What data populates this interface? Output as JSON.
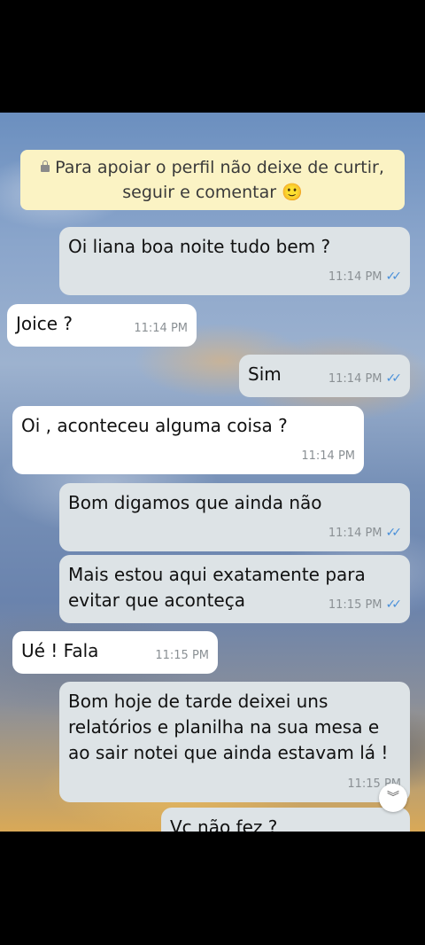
{
  "pinned": {
    "text": "Para apoiar o perfil não deixe de curtir, seguir e comentar 🙂"
  },
  "messages": [
    {
      "text": "Oi liana boa noite tudo bem ?",
      "time": "11:14 PM",
      "read": "✓✓"
    },
    {
      "text": "Joice ?",
      "time": "11:14 PM"
    },
    {
      "text": "Sim",
      "time": "11:14 PM",
      "read": "✓✓"
    },
    {
      "text": "Oi , aconteceu alguma coisa ?",
      "time": "11:14 PM"
    },
    {
      "text": "Bom digamos que ainda não",
      "time": "11:14 PM",
      "read": "✓✓"
    },
    {
      "text": "Mais estou aqui exatamente para evitar que aconteça",
      "time": "11:15 PM",
      "read": "✓✓"
    },
    {
      "text": "Ué ! Fala",
      "time": "11:15 PM"
    },
    {
      "text": "Bom hoje de tarde deixei uns relatórios e planilha na sua mesa e ao sair notei que ainda estavam lá !",
      "time": "11:15 PM"
    },
    {
      "text": "Vc não fez ?"
    }
  ],
  "scroll_button": {
    "icon": "double-chevron-down-icon",
    "glyph": "︾"
  },
  "colors": {
    "outgoing": "#dde3e6",
    "incoming": "#ffffff",
    "pinned": "#fbf3c4",
    "read_ticks": "#4a90d9"
  }
}
